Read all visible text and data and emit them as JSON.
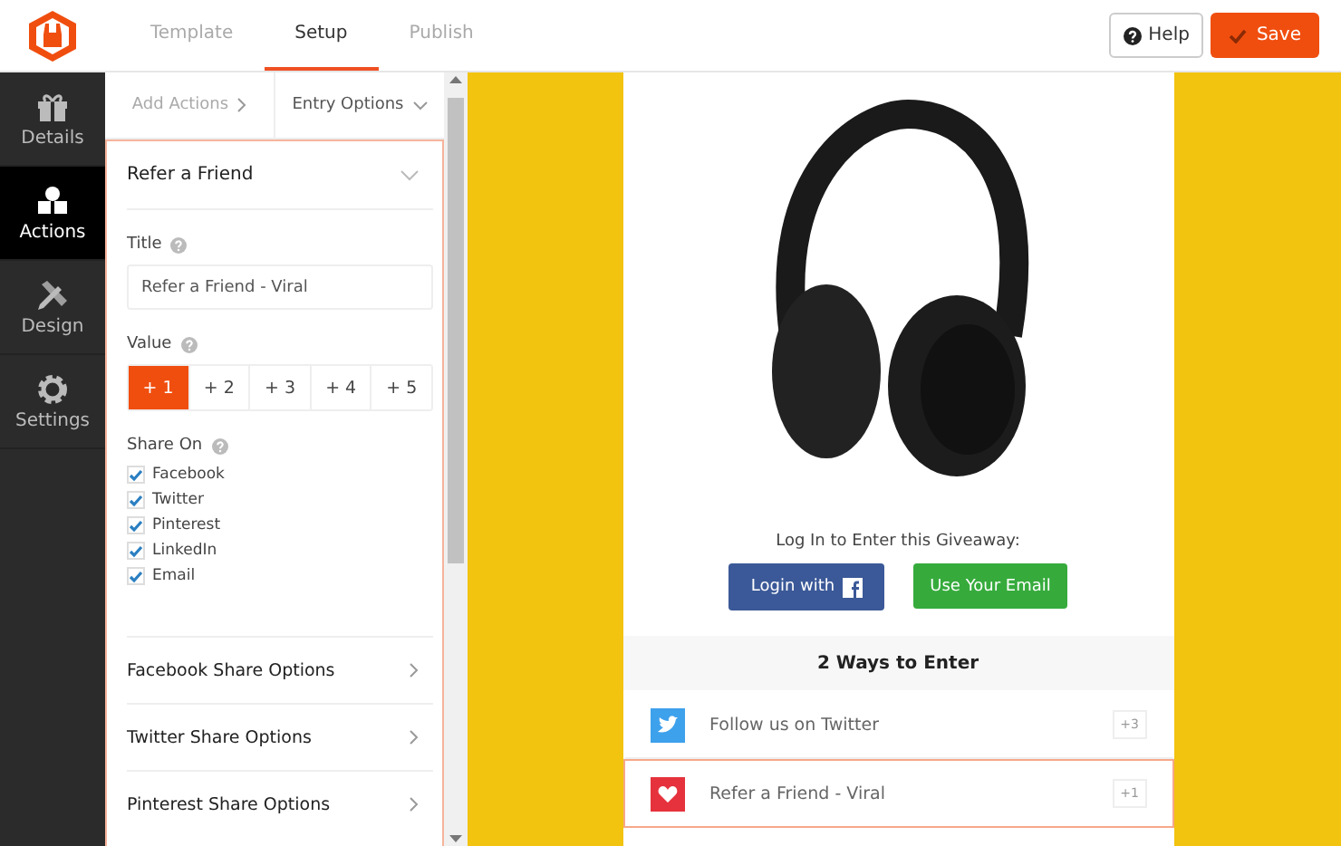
{
  "top_tabs": [
    {
      "label": "Template",
      "selected": false
    },
    {
      "label": "Setup",
      "selected": true
    },
    {
      "label": "Publish",
      "selected": false
    }
  ],
  "help_button": "Help",
  "save_button": "Save",
  "sidebar": [
    {
      "label": "Details",
      "kind": "gift",
      "selected": false
    },
    {
      "label": "Actions",
      "kind": "shapes",
      "selected": true
    },
    {
      "label": "Design",
      "kind": "tools",
      "selected": false
    },
    {
      "label": "Settings",
      "kind": "gear",
      "selected": false
    }
  ],
  "panel_tabs": [
    {
      "label": "Add Actions",
      "kind": "next"
    },
    {
      "label": "Entry Options",
      "kind": "down"
    }
  ],
  "action": {
    "title": "Refer a Friend",
    "expanded": true,
    "title_label": "Title",
    "title_value": "Refer a Friend - Viral",
    "value_label": "Value",
    "values": [
      {
        "label": "+ 1",
        "selected": true
      },
      {
        "label": "+ 2",
        "selected": false
      },
      {
        "label": "+ 3",
        "selected": false
      },
      {
        "label": "+ 4",
        "selected": false
      },
      {
        "label": "+ 5",
        "selected": false
      }
    ],
    "share_label": "Share On",
    "share_on": [
      {
        "label": "Facebook",
        "checked": true
      },
      {
        "label": "Twitter",
        "checked": true
      },
      {
        "label": "Pinterest",
        "checked": true
      },
      {
        "label": "LinkedIn",
        "checked": true
      },
      {
        "label": "Email",
        "checked": true
      }
    ],
    "sections": [
      "Facebook Share Options",
      "Twitter Share Options",
      "Pinterest Share Options"
    ]
  },
  "preview": {
    "login_prompt": "Log In to Enter this Giveaway:",
    "login_facebook": "Login with",
    "login_email": "Use Your Email",
    "ways_title": "2 Ways to Enter",
    "entries": [
      {
        "label": "Follow us on Twitter",
        "kind": "twitter",
        "points": "+3",
        "selected": false
      },
      {
        "label": "Refer a Friend - Viral",
        "kind": "heart",
        "points": "+1",
        "selected": true
      }
    ]
  }
}
